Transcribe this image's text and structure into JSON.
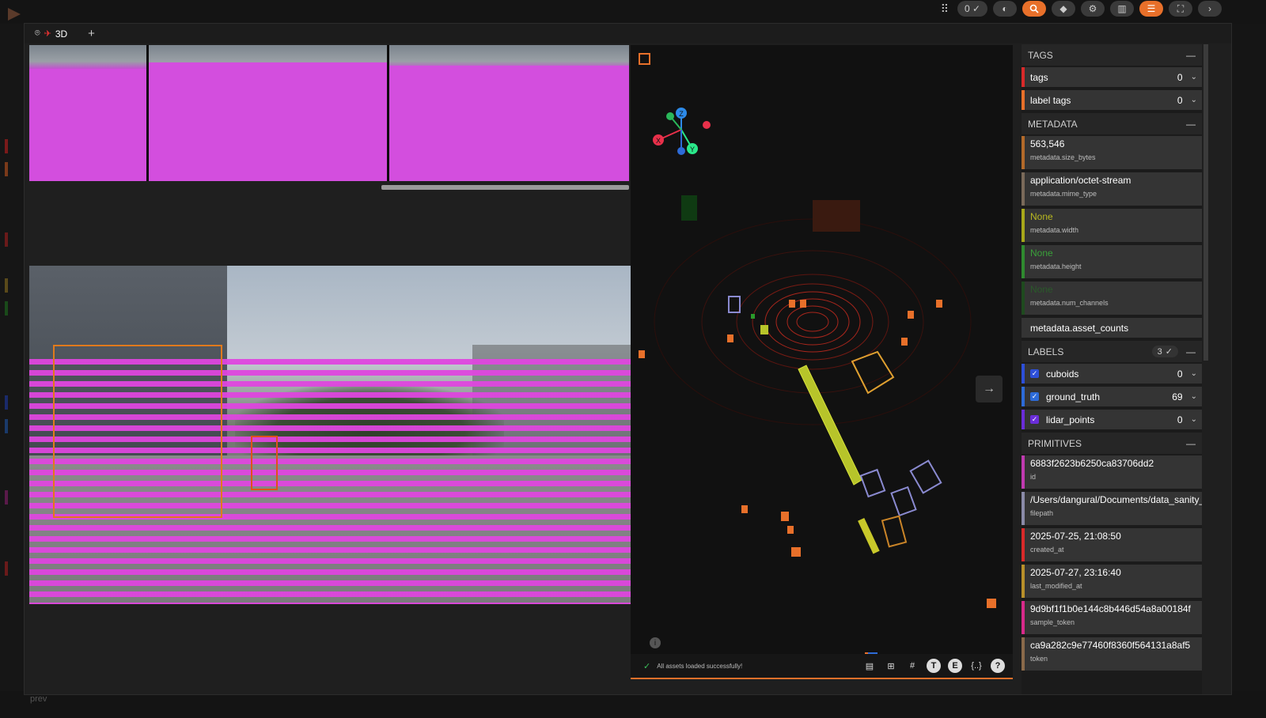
{
  "app": {
    "title": "FiftyOne"
  },
  "toolbar": {
    "selected_count": "0",
    "buttons": [
      "grip-icon",
      "selection-count",
      "palette-icon",
      "search-icon",
      "tag-icon",
      "gear-icon",
      "split-icon",
      "list-icon",
      "fullscreen-icon",
      "next-icon"
    ]
  },
  "tabs": [
    {
      "label": "3D"
    }
  ],
  "viewer": {
    "status_text": "All assets loaded successfully!",
    "axis_labels": {
      "x": "X",
      "y": "Y",
      "z": "Z"
    }
  },
  "sidebar": {
    "tags_header": "TAGS",
    "tags": [
      {
        "label": "tags",
        "count": "0",
        "color": "#d92a2a"
      },
      {
        "label": "label tags",
        "count": "0",
        "color": "#e8702a"
      }
    ],
    "metadata_header": "METADATA",
    "metadata": [
      {
        "value": "563,546",
        "key": "metadata.size_bytes",
        "color": "#b36a2a",
        "muted": false
      },
      {
        "value": "application/octet-stream",
        "key": "metadata.mime_type",
        "color": "#7a6a5a",
        "muted": false
      },
      {
        "value": "None",
        "key": "metadata.width",
        "color": "#a8a81a",
        "muted": true
      },
      {
        "value": "None",
        "key": "metadata.height",
        "color": "#2f8a2f",
        "muted": true
      },
      {
        "value": "None",
        "key": "metadata.num_channels",
        "color": "#2f6a2f",
        "muted": true
      }
    ],
    "asset_counts": "metadata.asset_counts",
    "labels_header": "LABELS",
    "labels_selected": "3",
    "labels": [
      {
        "label": "cuboids",
        "count": "0",
        "color": "#2d4fd8"
      },
      {
        "label": "ground_truth",
        "count": "69",
        "color": "#2d6bd8"
      },
      {
        "label": "lidar_points",
        "count": "0",
        "color": "#6a2dd8"
      }
    ],
    "primitives_header": "PRIMITIVES",
    "primitives": [
      {
        "value": "6883f2623b6250ca83706dd2",
        "key": "id",
        "color": "#c03ab0"
      },
      {
        "value": "/Users/dangural/Documents/data_sanity_",
        "key": "filepath",
        "color": "#8a8aa8"
      },
      {
        "value": "2025-07-25, 21:08:50",
        "key": "created_at",
        "color": "#d92a2a"
      },
      {
        "value": "2025-07-27, 23:16:40",
        "key": "last_modified_at",
        "color": "#b8902a"
      },
      {
        "value": "9d9bf1f1b0e144c8b446d54a8a00184f",
        "key": "sample_token",
        "color": "#d82a8a"
      },
      {
        "value": "ca9a282c9e77460f8360f564131a8af5",
        "key": "token",
        "color": "#8a6a4a"
      }
    ]
  },
  "background": {
    "prev_label": "prev"
  }
}
